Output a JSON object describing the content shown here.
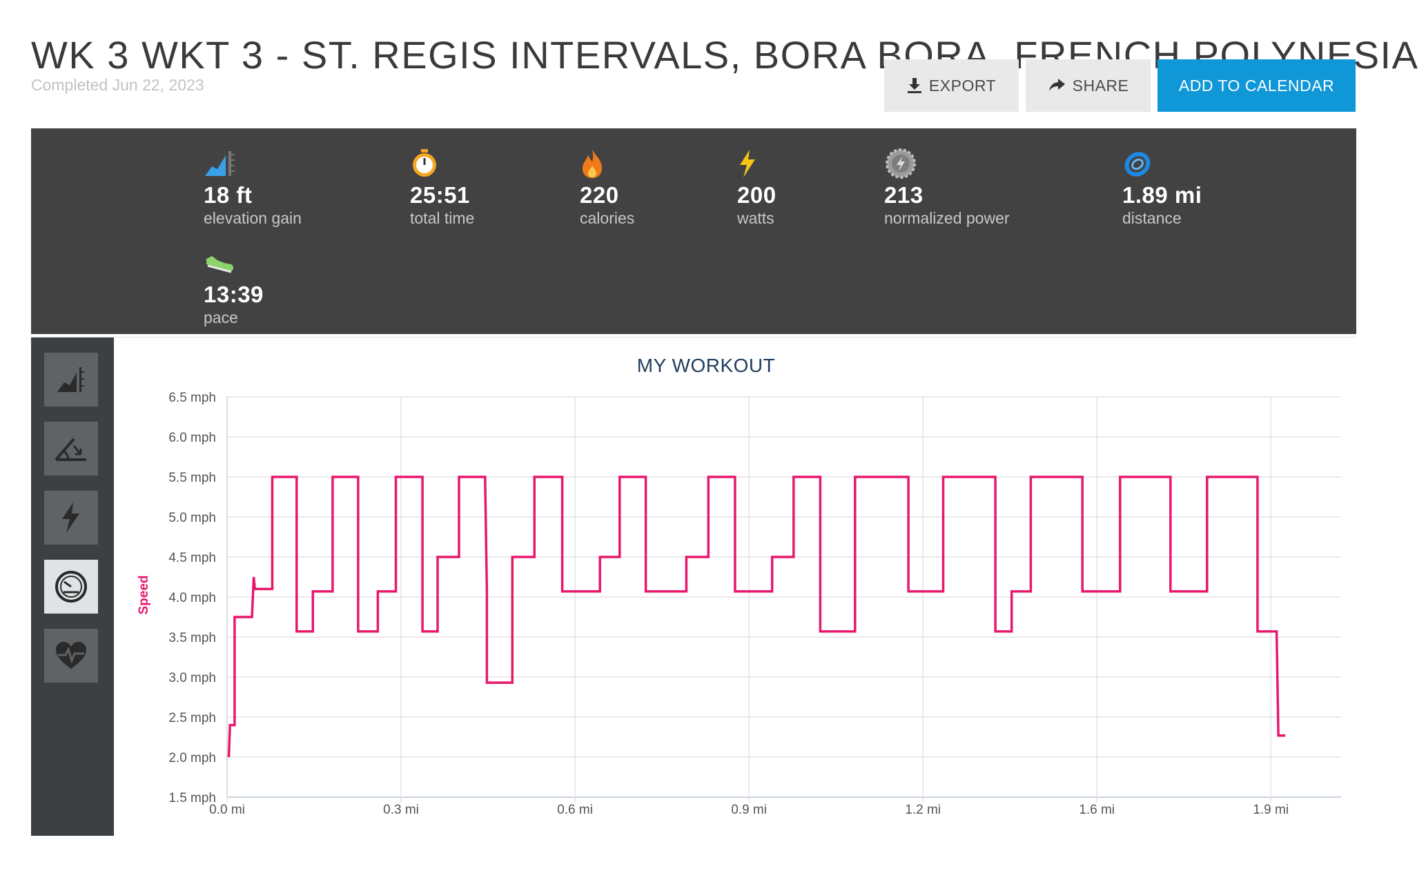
{
  "header": {
    "title": "WK 3 WKT 3 - ST. REGIS INTERVALS, BORA BORA, FRENCH POLYNESIA",
    "completed": "Completed Jun 22, 2023",
    "buttons": {
      "export": "EXPORT",
      "share": "SHARE",
      "add_to_calendar": "ADD TO CALENDAR"
    }
  },
  "stats": [
    {
      "icon": "elevation-icon",
      "value": "18 ft",
      "label": "elevation gain",
      "color": "#3aa0e8"
    },
    {
      "icon": "stopwatch-icon",
      "value": "25:51",
      "label": "total time",
      "color": "#f5a623"
    },
    {
      "icon": "flame-icon",
      "value": "220",
      "label": "calories",
      "color": "#f07a1a"
    },
    {
      "icon": "bolt-icon",
      "value": "200",
      "label": "watts",
      "color": "#f5c518"
    },
    {
      "icon": "gear-bolt-icon",
      "value": "213",
      "label": "normalized power",
      "color": "#9a9a9a"
    },
    {
      "icon": "distance-ring-icon",
      "value": "1.89 mi",
      "label": "distance",
      "color": "#1e88e5"
    },
    {
      "icon": "shoe-icon",
      "value": "13:39",
      "label": "pace",
      "color": "#8bd36a"
    }
  ],
  "sidebar": {
    "items": [
      {
        "icon": "elevation-icon",
        "active": false
      },
      {
        "icon": "incline-icon",
        "active": false
      },
      {
        "icon": "power-bolt-icon",
        "active": false
      },
      {
        "icon": "speedometer-icon",
        "active": true
      },
      {
        "icon": "heart-rate-icon",
        "active": false
      }
    ]
  },
  "chart_data": {
    "type": "line",
    "title": "MY WORKOUT",
    "ylabel": "Speed",
    "xlabel": "",
    "line_color": "#e8176c",
    "xlim": [
      0,
      1.92
    ],
    "ylim": [
      1.5,
      6.5
    ],
    "x_ticks": [
      {
        "value": 0.0,
        "label": "0.0 mi"
      },
      {
        "value": 0.3,
        "label": "0.3 mi"
      },
      {
        "value": 0.6,
        "label": "0.6 mi"
      },
      {
        "value": 0.9,
        "label": "0.9 mi"
      },
      {
        "value": 1.2,
        "label": "1.2 mi"
      },
      {
        "value": 1.5,
        "label": "1.6 mi"
      },
      {
        "value": 1.8,
        "label": "1.9 mi"
      }
    ],
    "y_ticks": [
      {
        "value": 1.5,
        "label": "1.5 mph"
      },
      {
        "value": 2.0,
        "label": "2.0 mph"
      },
      {
        "value": 2.5,
        "label": "2.5 mph"
      },
      {
        "value": 3.0,
        "label": "3.0 mph"
      },
      {
        "value": 3.5,
        "label": "3.5 mph"
      },
      {
        "value": 4.0,
        "label": "4.0 mph"
      },
      {
        "value": 4.5,
        "label": "4.5 mph"
      },
      {
        "value": 5.0,
        "label": "5.0 mph"
      },
      {
        "value": 5.5,
        "label": "5.5 mph"
      },
      {
        "value": 6.0,
        "label": "6.0 mph"
      },
      {
        "value": 6.5,
        "label": "6.5 mph"
      }
    ],
    "grid": true,
    "legend": "none",
    "series": [
      {
        "points": [
          [
            0.003,
            2.0
          ],
          [
            0.005,
            2.4
          ],
          [
            0.013,
            2.4
          ],
          [
            0.013,
            3.75
          ],
          [
            0.043,
            3.75
          ],
          [
            0.046,
            4.25
          ],
          [
            0.048,
            4.1
          ],
          [
            0.078,
            4.1
          ],
          [
            0.078,
            5.5
          ],
          [
            0.12,
            5.5
          ],
          [
            0.12,
            3.57
          ],
          [
            0.148,
            3.57
          ],
          [
            0.148,
            4.07
          ],
          [
            0.182,
            4.07
          ],
          [
            0.182,
            5.5
          ],
          [
            0.226,
            5.5
          ],
          [
            0.226,
            3.57
          ],
          [
            0.26,
            3.57
          ],
          [
            0.26,
            4.07
          ],
          [
            0.291,
            4.07
          ],
          [
            0.291,
            5.5
          ],
          [
            0.337,
            5.5
          ],
          [
            0.337,
            3.57
          ],
          [
            0.363,
            3.57
          ],
          [
            0.363,
            4.5
          ],
          [
            0.4,
            4.5
          ],
          [
            0.4,
            5.5
          ],
          [
            0.445,
            5.5
          ],
          [
            0.448,
            4.07
          ],
          [
            0.448,
            2.93
          ],
          [
            0.492,
            2.93
          ],
          [
            0.492,
            4.5
          ],
          [
            0.53,
            4.5
          ],
          [
            0.53,
            5.5
          ],
          [
            0.578,
            5.5
          ],
          [
            0.578,
            4.07
          ],
          [
            0.643,
            4.07
          ],
          [
            0.643,
            4.5
          ],
          [
            0.677,
            4.5
          ],
          [
            0.677,
            5.5
          ],
          [
            0.722,
            5.5
          ],
          [
            0.722,
            4.07
          ],
          [
            0.792,
            4.07
          ],
          [
            0.792,
            4.5
          ],
          [
            0.83,
            4.5
          ],
          [
            0.83,
            5.5
          ],
          [
            0.876,
            5.5
          ],
          [
            0.876,
            4.07
          ],
          [
            0.94,
            4.07
          ],
          [
            0.94,
            4.5
          ],
          [
            0.977,
            4.5
          ],
          [
            0.977,
            5.5
          ],
          [
            1.023,
            5.5
          ],
          [
            1.023,
            3.57
          ],
          [
            1.083,
            3.57
          ],
          [
            1.083,
            5.5
          ],
          [
            1.175,
            5.5
          ],
          [
            1.175,
            4.07
          ],
          [
            1.235,
            4.07
          ],
          [
            1.235,
            5.5
          ],
          [
            1.325,
            5.5
          ],
          [
            1.325,
            3.57
          ],
          [
            1.353,
            3.57
          ],
          [
            1.353,
            4.07
          ],
          [
            1.386,
            4.07
          ],
          [
            1.386,
            5.5
          ],
          [
            1.475,
            5.5
          ],
          [
            1.475,
            4.07
          ],
          [
            1.54,
            4.07
          ],
          [
            1.54,
            5.5
          ],
          [
            1.627,
            5.5
          ],
          [
            1.627,
            4.07
          ],
          [
            1.69,
            4.07
          ],
          [
            1.69,
            5.5
          ],
          [
            1.777,
            5.5
          ],
          [
            1.777,
            3.57
          ],
          [
            1.81,
            3.57
          ],
          [
            1.813,
            2.27
          ],
          [
            1.825,
            2.27
          ]
        ]
      }
    ]
  }
}
